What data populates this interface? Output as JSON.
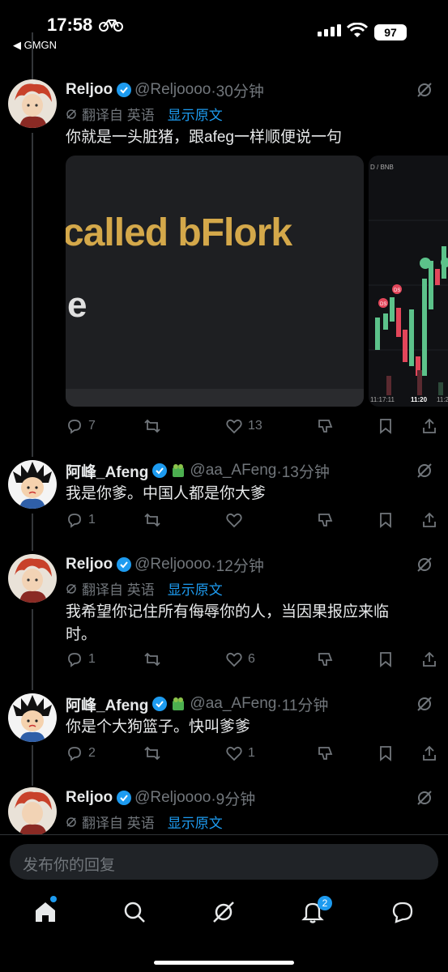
{
  "status": {
    "time": "17:58",
    "back_label": "◀ GMGN",
    "battery": "97"
  },
  "posts": [
    {
      "name": "Reljoo",
      "handle": "@Reljoooo",
      "time": "·30分钟",
      "translated_from": "翻译自 英语",
      "show_original": "显示原文",
      "text": "你就是一头脏猪，跟afeg一样顺便说一句",
      "media_text": "called bFlork",
      "media_text2": "e",
      "chart_labels": [
        "D / BNB",
        "DS",
        "DS",
        "11:17:11",
        "11:20",
        "11:2"
      ],
      "replies": "7",
      "retweets": "",
      "likes": "13"
    },
    {
      "name": "阿峰_Afeng",
      "handle": "@aa_AFeng",
      "time": "·13分钟",
      "text": "我是你爹。中国人都是你大爹",
      "replies": "1",
      "retweets": "",
      "likes": ""
    },
    {
      "name": "Reljoo",
      "handle": "@Reljoooo",
      "time": "·12分钟",
      "translated_from": "翻译自 英语",
      "show_original": "显示原文",
      "text": "我希望你记住所有侮辱你的人，当因果报应来临时。",
      "replies": "1",
      "retweets": "",
      "likes": "6"
    },
    {
      "name": "阿峰_Afeng",
      "handle": "@aa_AFeng",
      "time": "·11分钟",
      "text": "你是个大狗篮子。快叫爹爹",
      "replies": "2",
      "retweets": "",
      "likes": "1"
    },
    {
      "name": "Reljoo",
      "handle": "@Reljoooo",
      "time": "·9分钟",
      "translated_from": "翻译自 英语",
      "show_original": "显示原文"
    }
  ],
  "reply_placeholder": "发布你的回复",
  "notifications_badge": "2",
  "colors": {
    "accent": "#1d9bf0",
    "muted": "#71767b",
    "text": "#e7e9ea",
    "background": "#000000"
  }
}
